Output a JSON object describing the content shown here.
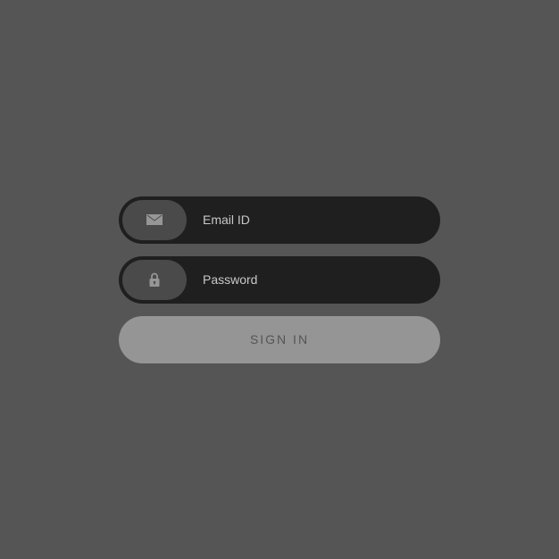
{
  "form": {
    "email": {
      "placeholder": "Email ID",
      "value": ""
    },
    "password": {
      "placeholder": "Password",
      "value": ""
    },
    "submit_label": "SIGN IN"
  }
}
